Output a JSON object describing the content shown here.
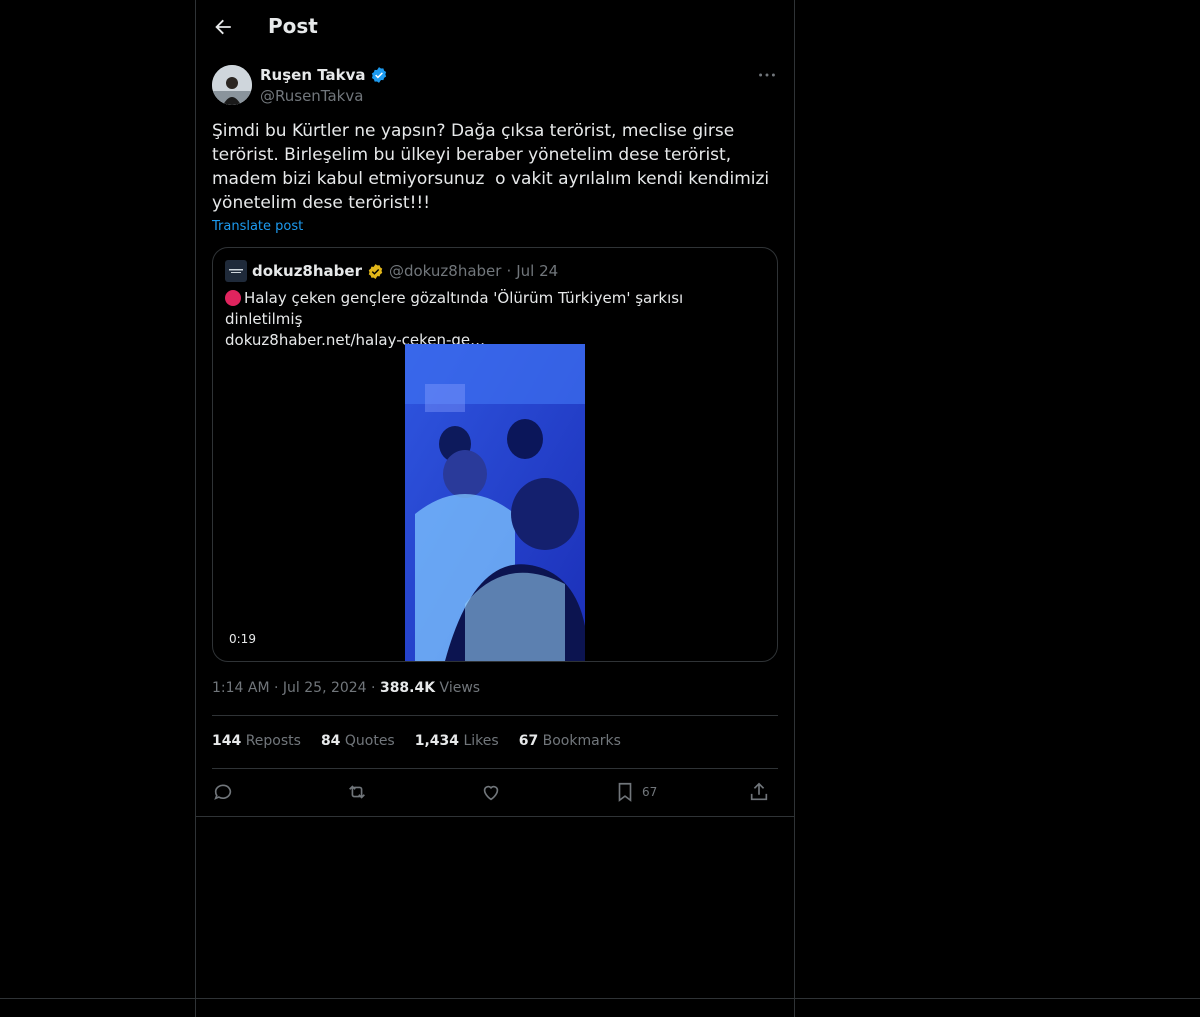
{
  "header": {
    "title": "Post"
  },
  "author": {
    "name": "Ruşen Takva",
    "handle": "@RusenTakva"
  },
  "post": {
    "text": "Şimdi bu Kürtler ne yapsın? Dağa çıksa terörist, meclise girse terörist. Birleşelim bu ülkeyi beraber yönetelim dese terörist, madem bizi kabul etmiyorsunuz  o vakit ayrılalım kendi kendimizi yönetelim dese terörist!!!",
    "translate_label": "Translate post"
  },
  "quote": {
    "name": "dokuz8haber",
    "handle": "@dokuz8haber",
    "separator": "·",
    "date": "Jul 24",
    "text": "Halay çeken gençlere gözaltında 'Ölürüm Türkiyem' şarkısı dinletilmiş",
    "link": "dokuz8haber.net/halay-ceken-ge…",
    "video_duration": "0:19"
  },
  "timeline": {
    "time": "1:14 AM",
    "dot": "·",
    "date": "Jul 25, 2024",
    "views_count": "388.4K",
    "views_label": "Views"
  },
  "stats": [
    {
      "count": "144",
      "label": "Reposts"
    },
    {
      "count": "84",
      "label": "Quotes"
    },
    {
      "count": "1,434",
      "label": "Likes"
    },
    {
      "count": "67",
      "label": "Bookmarks"
    }
  ],
  "actions": {
    "bookmark_count": "67"
  },
  "colors": {
    "background": "#000000",
    "accent": "#1d9bf0",
    "verified": "#1d9bf0",
    "gold_badge": "#e2b719",
    "muted": "#71767b"
  },
  "icons": [
    "back-arrow-icon",
    "verified-badge-icon",
    "more-icon",
    "reply-icon",
    "repost-icon",
    "like-icon",
    "bookmark-icon",
    "share-icon"
  ]
}
